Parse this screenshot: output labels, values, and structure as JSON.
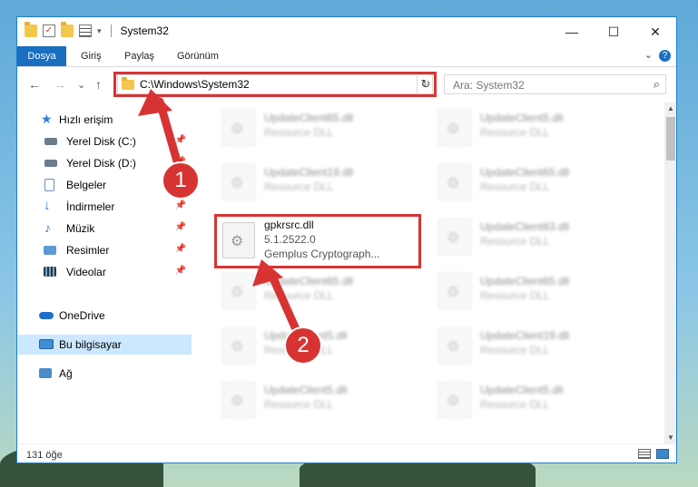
{
  "window": {
    "title": "System32"
  },
  "titlebar": {
    "minimize_glyph": "—",
    "maximize_glyph": "☐",
    "close_glyph": "✕"
  },
  "ribbon": {
    "tabs": [
      "Dosya",
      "Giriş",
      "Paylaş",
      "Görünüm"
    ],
    "expand_glyph": "⌄",
    "help_glyph": "?"
  },
  "nav": {
    "back_glyph": "←",
    "forward_glyph": "→",
    "recent_glyph": "⌄",
    "up_glyph": "↑",
    "address": "C:\\Windows\\System32",
    "address_dropdown_glyph": "⌄",
    "refresh_glyph": "↻",
    "search_placeholder": "Ara: System32",
    "search_glyph": "⌕"
  },
  "sidebar": {
    "items": [
      {
        "label": "Hızlı erişim",
        "icon": "star-icon",
        "pinned": false
      },
      {
        "label": "Yerel Disk (C:)",
        "icon": "drive-icon",
        "pinned": true
      },
      {
        "label": "Yerel Disk (D:)",
        "icon": "drive-icon",
        "pinned": true
      },
      {
        "label": "Belgeler",
        "icon": "documents-icon",
        "pinned": true
      },
      {
        "label": "İndirmeler",
        "icon": "download-icon",
        "pinned": true
      },
      {
        "label": "Müzik",
        "icon": "music-icon",
        "pinned": true
      },
      {
        "label": "Resimler",
        "icon": "pictures-icon",
        "pinned": true
      },
      {
        "label": "Videolar",
        "icon": "videos-icon",
        "pinned": true
      },
      {
        "label": "OneDrive",
        "icon": "cloud-icon",
        "pinned": false
      },
      {
        "label": "Bu bilgisayar",
        "icon": "computer-icon",
        "pinned": false
      },
      {
        "label": "Ağ",
        "icon": "network-icon",
        "pinned": false
      }
    ],
    "pin_glyph": "📌"
  },
  "files": {
    "left": [
      {
        "name": "UpdateClient65.dll",
        "type": "Resource DLL"
      },
      {
        "name": "UpdateClient19.dll",
        "type": "Resource DLL"
      },
      {
        "name": "gpkrsrc.dll",
        "version": "5.1.2522.0",
        "description": "Gemplus Cryptograph..."
      },
      {
        "name": "UpdateClient65.dll",
        "type": "Resource DLL"
      },
      {
        "name": "UpdateClient5.dll",
        "type": "Resource DLL"
      },
      {
        "name": "UpdateClient5.dll",
        "type": "Resource DLL"
      }
    ],
    "right": [
      {
        "name": "UpdateClient5.dll",
        "type": "Resource DLL"
      },
      {
        "name": "UpdateClient65.dll",
        "type": "Resource DLL"
      },
      {
        "name": "UpdateClient63.dll",
        "type": "Resource DLL"
      },
      {
        "name": "UpdateClient65.dll",
        "type": "Resource DLL"
      },
      {
        "name": "UpdateClient19.dll",
        "type": "Resource DLL"
      },
      {
        "name": "UpdateClient5.dll",
        "type": "Resource DLL"
      }
    ]
  },
  "status": {
    "count": "131 öğe"
  },
  "annotations": {
    "one": "1",
    "two": "2",
    "color": "#d83333"
  }
}
